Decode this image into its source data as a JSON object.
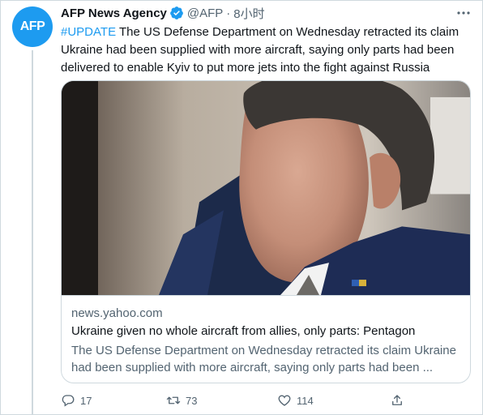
{
  "tweet": {
    "avatar_text": "AFP",
    "name": "AFP News Agency",
    "handle": "@AFP",
    "separator": "·",
    "time": "8小时",
    "hashtag": "#UPDATE",
    "body": " The US Defense Department on Wednesday retracted its claim Ukraine had been supplied with more aircraft, saying only parts had been delivered to enable Kyiv to put more jets into the fight against Russia"
  },
  "card": {
    "domain": "news.yahoo.com",
    "title": "Ukraine given no whole aircraft from allies, only parts: Pentagon",
    "description": "The US Defense Department on Wednesday retracted its claim Ukraine had been supplied with more aircraft, saying only parts had been ..."
  },
  "actions": {
    "reply_count": "17",
    "retweet_count": "73",
    "like_count": "114"
  },
  "colors": {
    "accent": "#1d9bf0",
    "secondary_text": "#536471",
    "border": "#cfd9de"
  },
  "icons": [
    "verified-badge-icon",
    "more-icon",
    "reply-icon",
    "retweet-icon",
    "like-icon",
    "share-icon"
  ]
}
